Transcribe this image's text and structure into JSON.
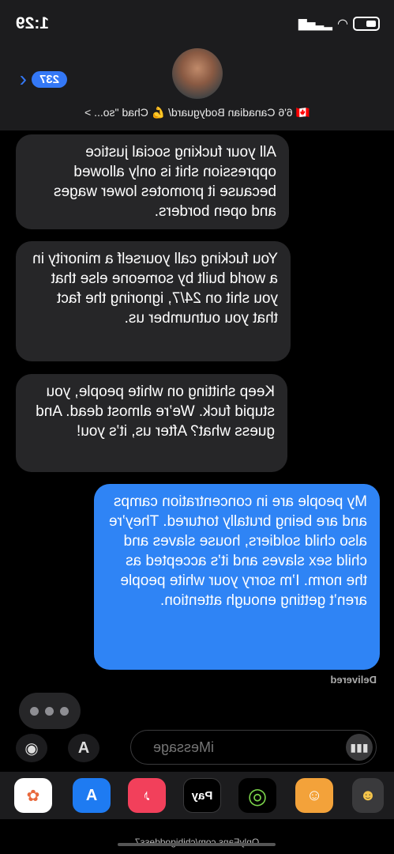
{
  "status_bar": {
    "time": "1:29"
  },
  "header": {
    "unread_count": "237",
    "contact_name": "🇨🇦 6'6 Canadian Bodyguard/ 💪 Chad \"so... >"
  },
  "messages": [
    {
      "side": "received",
      "text": "All your fucking social justice oppression shit is only allowed because it promotes lower wages and open borders."
    },
    {
      "side": "received",
      "text": "You fucking call yourself a minority in a world built by someone else that you shit on 24/7, ignoring the fact that you outnumber us."
    },
    {
      "side": "received",
      "text": "Keep shitting on white people, you stupid fuck. We’re almost dead. And guess what? After us, it’s you!"
    },
    {
      "side": "sent",
      "text": "My people are in concentration camps and are being brutally tortured. They’re also child soldiers, house slaves and child sex slaves and it’s accepted as the norm. I’m sorry your white people aren’t getting enough attention."
    }
  ],
  "delivered_label": "Delivered",
  "composer": {
    "placeholder": "iMessage"
  },
  "apps_icon_label": "A",
  "app_tray": [
    {
      "name": "photos",
      "label": "✿",
      "color": "#ffffff"
    },
    {
      "name": "app-store",
      "label": "A",
      "color": "#1e7bf2"
    },
    {
      "name": "music",
      "label": "♪",
      "color": "#f2405b"
    },
    {
      "name": "apple-pay",
      "label": "Pay",
      "color": "#000000"
    },
    {
      "name": "activity",
      "label": "◎",
      "color": "#000000"
    },
    {
      "name": "memoji",
      "label": "☺",
      "color": "#f3a23a"
    },
    {
      "name": "animoji",
      "label": "☻",
      "color": "#3a3a3c"
    }
  ],
  "watermark": "OnlyFans.com/chibigoddess7"
}
